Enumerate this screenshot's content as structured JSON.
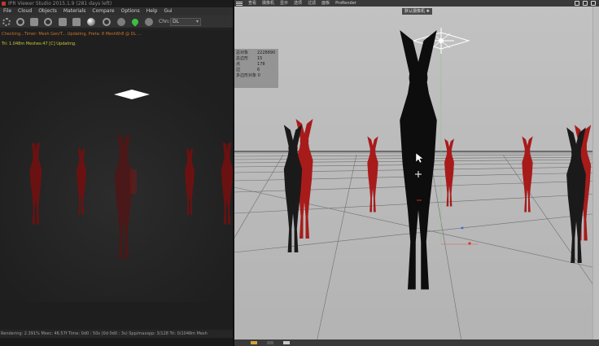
{
  "left_window": {
    "title": "IPR Viewer Studio 2015.1.9 (281 days left)",
    "menu": [
      "File",
      "Cloud",
      "Objects",
      "Materials",
      "Compare",
      "Options",
      "Help",
      "Gui"
    ],
    "channel_label": "Chn:",
    "channel_value": "DL",
    "log_line_1": "Checking...Timer: Mesh Gen/T... Updating, Preta: 8 Mesh6h8 @ DL ...",
    "log_line_2": "Tri: 1.048m Meshes:47   [C] Updating.",
    "status_bar": "Rendering: 2.391%  Msec: 46.57f  Time: 0d0 : 50s  (0d 0d0 : 3s)  Spp/maxspp: 3/128  Tri: 0/1048m Mesh"
  },
  "viewport": {
    "menu": [
      "查看",
      "摄像机",
      "显示",
      "选项",
      "过滤",
      "面板",
      "ProRender"
    ],
    "camera_label": "默认摄像机 ✚",
    "hud": [
      {
        "key": "总对象",
        "value": "2228890"
      },
      {
        "key": "总边形",
        "value": "15"
      },
      {
        "key": "点",
        "value": "178"
      },
      {
        "key": "边",
        "value": "6"
      },
      {
        "key": "多边形对象 0",
        "value": ""
      }
    ]
  },
  "colors": {
    "figure_red": "#a81b1b",
    "figure_dark": "#0d0d0d",
    "left_bg": "#242424",
    "viewport_bg": "#b9b9b9"
  }
}
